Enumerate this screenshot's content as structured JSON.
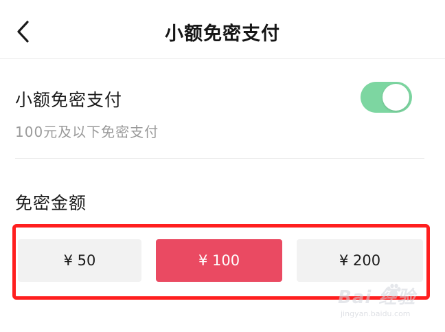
{
  "header": {
    "title": "小额免密支付"
  },
  "setting": {
    "title": "小额免密支付",
    "description": "100元及以下免密支付",
    "toggle_on": true
  },
  "amount_section": {
    "label": "免密金额",
    "options": [
      {
        "label": "¥ 50",
        "selected": false
      },
      {
        "label": "¥ 100",
        "selected": true
      },
      {
        "label": "¥ 200",
        "selected": false
      }
    ]
  },
  "colors": {
    "accent": "#ea4a62",
    "toggle": "#7dd6a1",
    "highlight": "#ff1f1f"
  },
  "watermark": {
    "main": "Bai 经验",
    "sub": "jingyan.baidu.com"
  }
}
